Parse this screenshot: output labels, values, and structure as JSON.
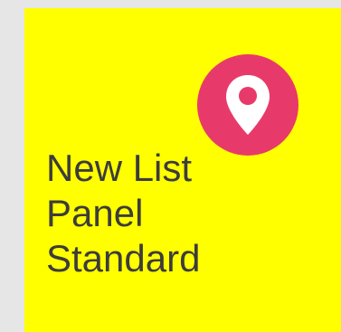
{
  "tile": {
    "title_lines": [
      "New List",
      "Panel",
      "Standard"
    ],
    "icon": "map-pin-icon",
    "background_color": "#ffff00",
    "badge_color": "#e83a6a",
    "text_color": "#3c3c3c",
    "page_background": "#e6e6e6"
  }
}
